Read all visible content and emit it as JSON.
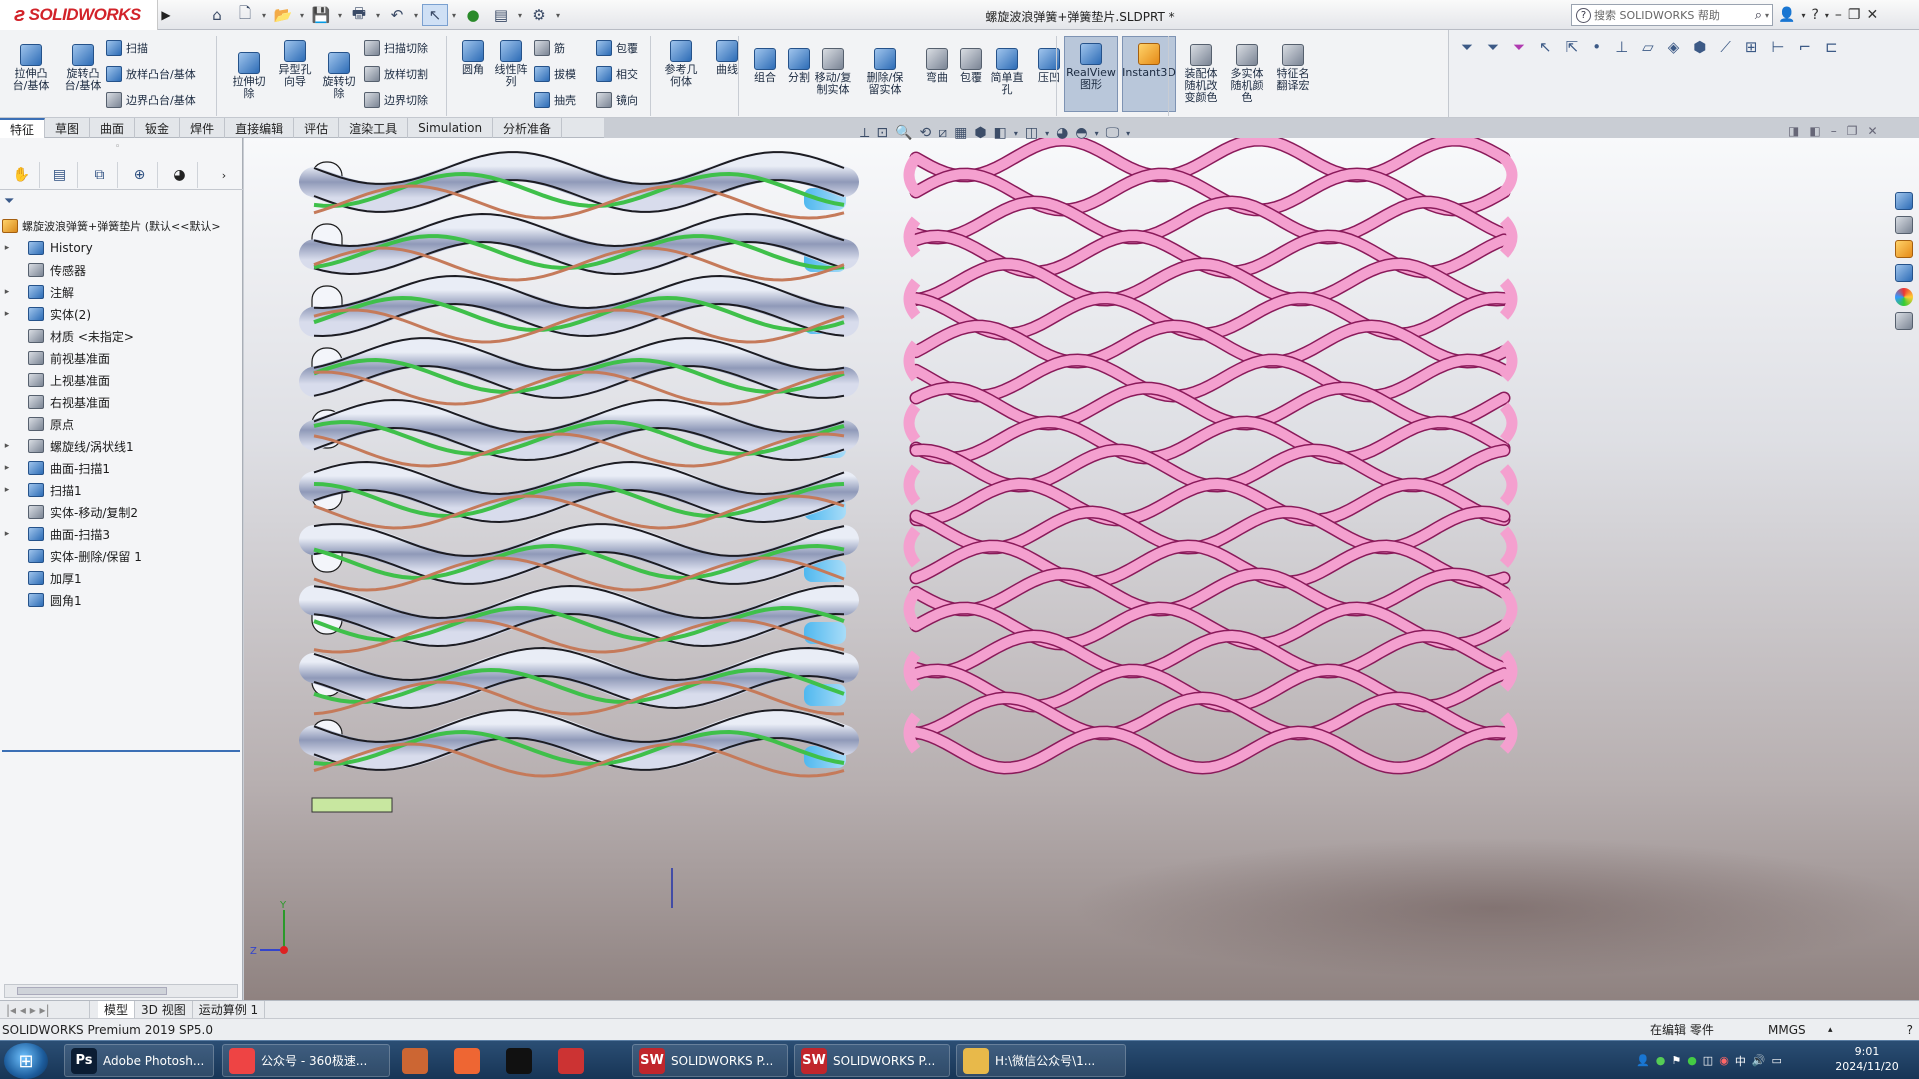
{
  "app": {
    "brand": "SOLIDWORKS",
    "document_title": "螺旋波浪弹簧+弹簧垫片.SLDPRT *",
    "search_placeholder": "搜索 SOLIDWORKS 帮助"
  },
  "ribbon": {
    "buttons": [
      {
        "id": "extrude-boss",
        "label": "拉伸凸\n台/基体",
        "icon": "extrude-boss-icon"
      },
      {
        "id": "revolve-boss",
        "label": "旋转凸\n台/基体",
        "icon": "revolve-boss-icon"
      },
      {
        "id": "sweep",
        "label": "扫描",
        "icon": "sweep-icon"
      },
      {
        "id": "loft-boss",
        "label": "放样凸台/基体",
        "icon": "loft-icon"
      },
      {
        "id": "boundary-boss",
        "label": "边界凸台/基体",
        "icon": "boundary-icon"
      },
      {
        "id": "extrude-cut",
        "label": "拉伸切\n除",
        "icon": "extrude-cut-icon"
      },
      {
        "id": "hole-wizard",
        "label": "异型孔\n向导",
        "icon": "hole-wizard-icon"
      },
      {
        "id": "revolve-cut",
        "label": "旋转切\n除",
        "icon": "revolve-cut-icon"
      },
      {
        "id": "swept-cut",
        "label": "扫描切除",
        "icon": "swept-cut-icon"
      },
      {
        "id": "lofted-cut",
        "label": "放样切割",
        "icon": "lofted-cut-icon"
      },
      {
        "id": "boundary-cut",
        "label": "边界切除",
        "icon": "boundary-cut-icon"
      },
      {
        "id": "fillet",
        "label": "圆角",
        "icon": "fillet-icon"
      },
      {
        "id": "linear-pattern",
        "label": "线性阵\n列",
        "icon": "linear-pattern-icon"
      },
      {
        "id": "rib",
        "label": "筋",
        "icon": "rib-icon"
      },
      {
        "id": "draft",
        "label": "拔模",
        "icon": "draft-icon"
      },
      {
        "id": "shell",
        "label": "抽壳",
        "icon": "shell-icon"
      },
      {
        "id": "wrap",
        "label": "包覆",
        "icon": "wrap-icon"
      },
      {
        "id": "intersect",
        "label": "相交",
        "icon": "intersect-icon"
      },
      {
        "id": "mirror",
        "label": "镜向",
        "icon": "mirror-icon"
      },
      {
        "id": "ref-geometry",
        "label": "参考几\n何体",
        "icon": "reference-geometry-icon"
      },
      {
        "id": "curves",
        "label": "曲线",
        "icon": "curves-icon"
      },
      {
        "id": "combine",
        "label": "组合",
        "icon": "combine-icon"
      },
      {
        "id": "split",
        "label": "分割",
        "icon": "split-icon"
      },
      {
        "id": "move-copy",
        "label": "移动/复\n制实体",
        "icon": "move-copy-icon"
      },
      {
        "id": "delete-keep",
        "label": "删除/保\n留实体",
        "icon": "delete-keep-icon"
      },
      {
        "id": "flex",
        "label": "弯曲",
        "icon": "flex-icon"
      },
      {
        "id": "wrap2",
        "label": "包覆",
        "icon": "wrap-icon"
      },
      {
        "id": "simple-hole",
        "label": "简单直\n孔",
        "icon": "simple-hole-icon"
      },
      {
        "id": "indent",
        "label": "压凹",
        "icon": "indent-icon"
      },
      {
        "id": "realview",
        "label": "RealView\n图形",
        "icon": "realview-icon"
      },
      {
        "id": "instant3d",
        "label": "Instant3D",
        "icon": "instant3d-icon"
      },
      {
        "id": "assembly-color",
        "label": "装配体\n随机改\n变颜色",
        "icon": "assembly-color-icon"
      },
      {
        "id": "multibody-color",
        "label": "多实体\n随机颜\n色",
        "icon": "multibody-color-icon"
      },
      {
        "id": "feature-rename",
        "label": "特征名\n翻译宏",
        "icon": "feature-rename-icon"
      }
    ]
  },
  "tabs": [
    "特征",
    "草图",
    "曲面",
    "钣金",
    "焊件",
    "直接编辑",
    "评估",
    "渲染工具",
    "Simulation",
    "分析准备"
  ],
  "feature_tree": {
    "root_label": "螺旋波浪弹簧+弹簧垫片 (默认<<默认>",
    "items": [
      {
        "label": "History",
        "expand": "▸",
        "icon": "history-icon"
      },
      {
        "label": "传感器",
        "expand": "",
        "icon": "sensor-icon"
      },
      {
        "label": "注解",
        "expand": "▸",
        "icon": "annotation-icon"
      },
      {
        "label": "实体(2)",
        "expand": "▸",
        "icon": "solid-bodies-icon"
      },
      {
        "label": "材质 <未指定>",
        "expand": "",
        "icon": "material-icon"
      },
      {
        "label": "前视基准面",
        "expand": "",
        "icon": "plane-icon"
      },
      {
        "label": "上视基准面",
        "expand": "",
        "icon": "plane-icon"
      },
      {
        "label": "右视基准面",
        "expand": "",
        "icon": "plane-icon"
      },
      {
        "label": "原点",
        "expand": "",
        "icon": "origin-icon"
      },
      {
        "label": "螺旋线/涡状线1",
        "expand": "▸",
        "icon": "helix-icon"
      },
      {
        "label": "曲面-扫描1",
        "expand": "▸",
        "icon": "surface-sweep-icon"
      },
      {
        "label": "扫描1",
        "expand": "▸",
        "icon": "sweep-icon"
      },
      {
        "label": "实体-移动/复制2",
        "expand": "",
        "icon": "move-copy-icon"
      },
      {
        "label": "曲面-扫描3",
        "expand": "▸",
        "icon": "surface-sweep-icon"
      },
      {
        "label": "实体-删除/保留 1",
        "expand": "",
        "icon": "delete-keep-icon"
      },
      {
        "label": "加厚1",
        "expand": "",
        "icon": "thicken-icon"
      },
      {
        "label": "圆角1",
        "expand": "",
        "icon": "fillet-icon"
      }
    ]
  },
  "bottom_tabs": [
    "模型",
    "3D 视图",
    "运动算例 1"
  ],
  "status": {
    "version": "SOLIDWORKS Premium 2019 SP5.0",
    "mode": "在编辑 零件",
    "units": "MMGS"
  },
  "taskbar": {
    "items": [
      {
        "label": "Adobe Photosh...",
        "icon": "photoshop-icon",
        "badge": "Ps",
        "color": "#0b1d33"
      },
      {
        "label": "公众号 - 360极速...",
        "icon": "browser-icon",
        "badge": "",
        "color": "#e44"
      },
      {
        "label": "",
        "icon": "paint-icon",
        "badge": "",
        "color": "#c63"
      },
      {
        "label": "",
        "icon": "app-icon",
        "badge": "",
        "color": "#e63"
      },
      {
        "label": "",
        "icon": "record-icon",
        "badge": "",
        "color": "#111"
      },
      {
        "label": "",
        "icon": "tool-icon",
        "badge": "",
        "color": "#c33"
      },
      {
        "label": "SOLIDWORKS P...",
        "icon": "solidworks-icon",
        "badge": "SW",
        "color": "#c0262c"
      },
      {
        "label": "SOLIDWORKS P...",
        "icon": "solidworks-icon",
        "badge": "SW",
        "color": "#c0262c"
      },
      {
        "label": "H:\\微信公众号\\1...",
        "icon": "folder-icon",
        "badge": "",
        "color": "#e8b94a"
      }
    ],
    "time": "9:01",
    "date": "2024/11/20"
  },
  "colors": {
    "spring_pink": "#f4a0cf",
    "spring_edge": "#8a1a5a",
    "washer_steel": "#a9b3c8",
    "washer_green": "#3fc04a",
    "washer_copper": "#c57a5a",
    "accent": "#3b6fb5"
  }
}
